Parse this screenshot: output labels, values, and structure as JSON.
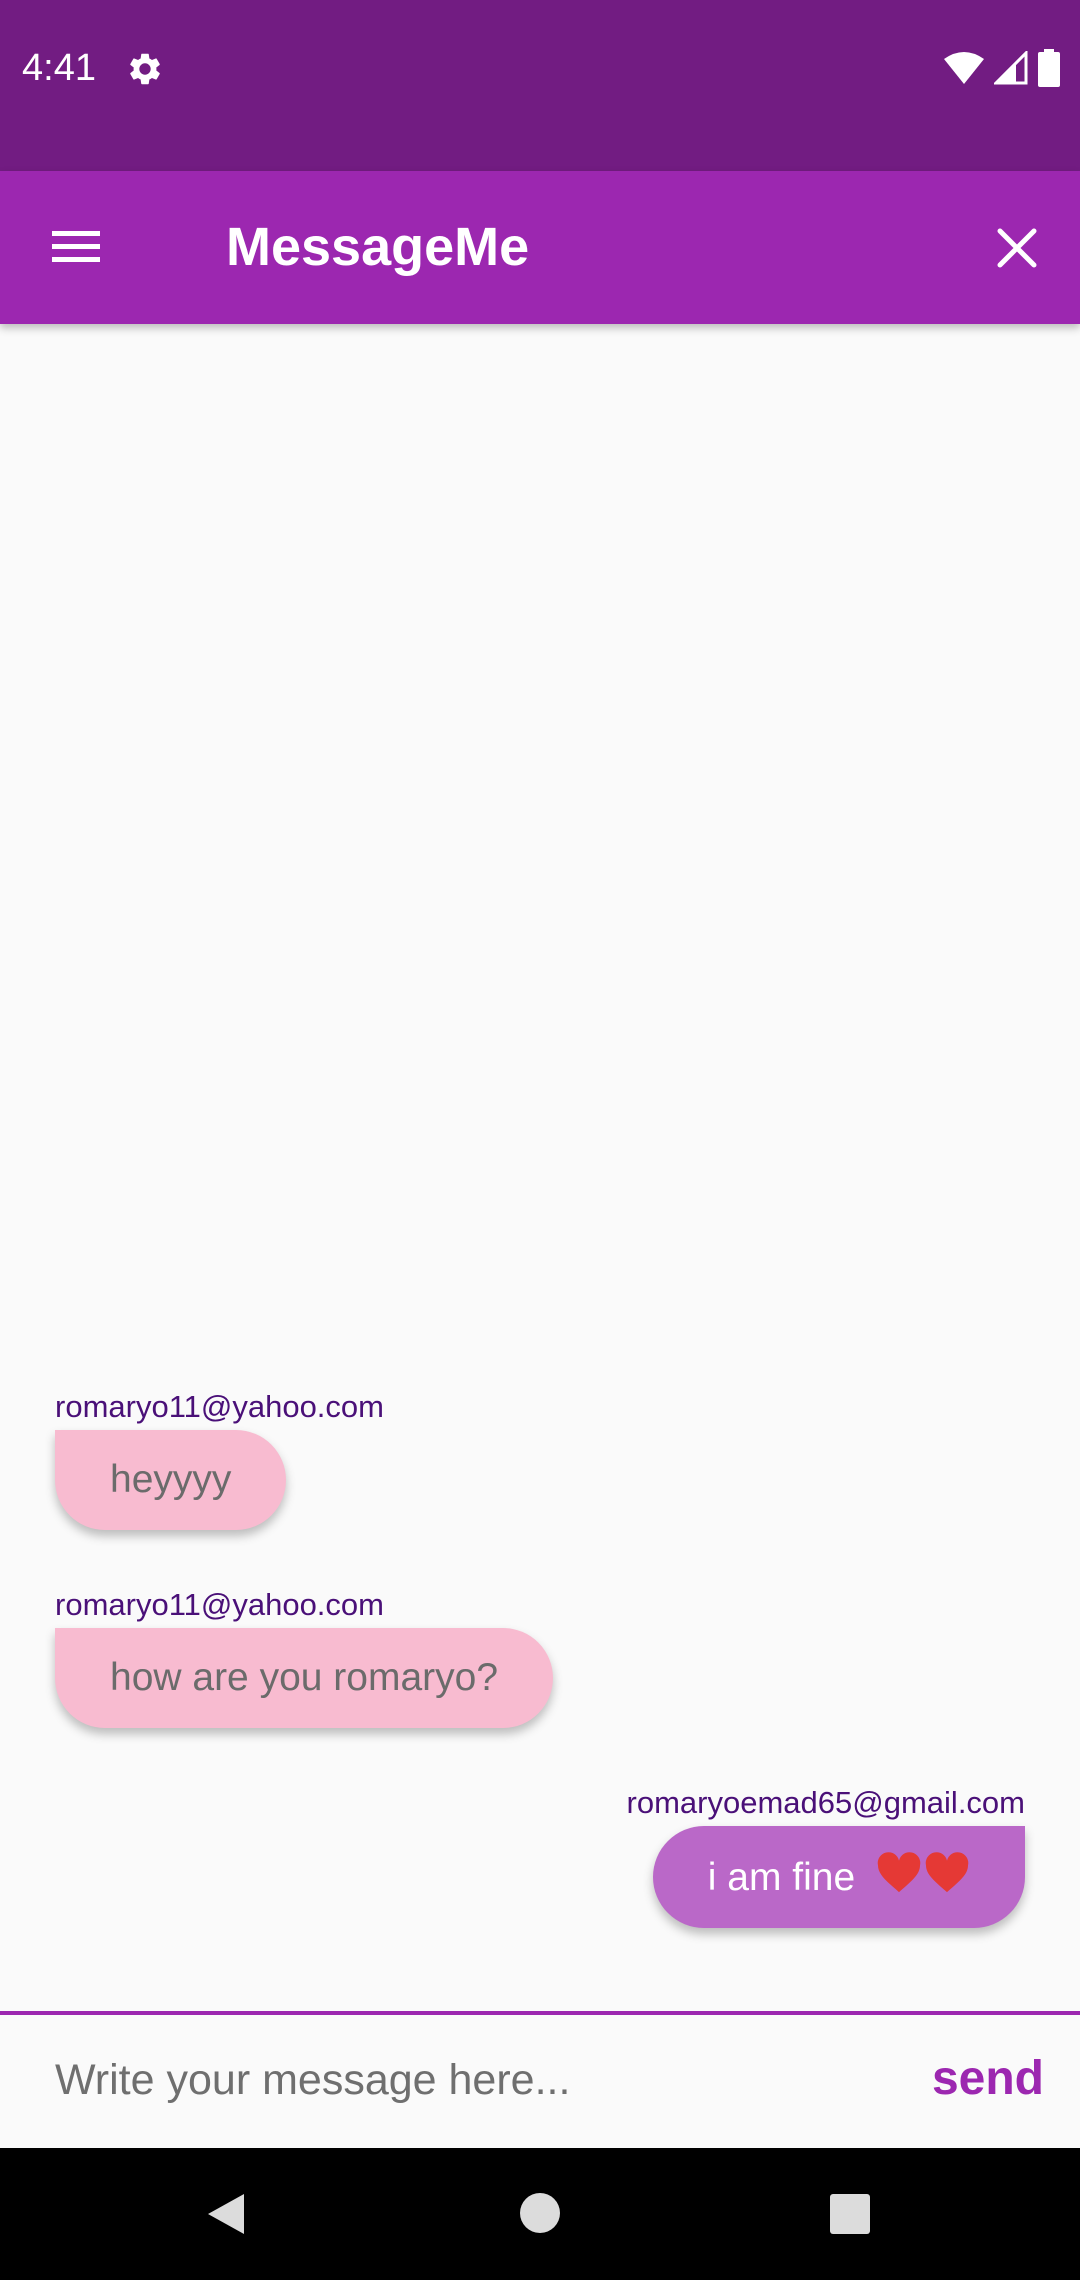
{
  "status_bar": {
    "time": "4:41",
    "icons": [
      "settings-gear-icon",
      "wifi-icon",
      "cell-signal-icon",
      "battery-icon"
    ]
  },
  "app_bar": {
    "title": "MessageMe",
    "menu_icon": "menu-icon",
    "close_icon": "close-icon",
    "color": "#9c27b0"
  },
  "messages": [
    {
      "sender": "romaryo11@yahoo.com",
      "text": "heyyyy",
      "direction": "incoming"
    },
    {
      "sender": "romaryo11@yahoo.com",
      "text": "how are you romaryo?",
      "direction": "incoming"
    },
    {
      "sender": "romaryoemad65@gmail.com",
      "text": "i am fine",
      "emoji": "heart-emoji x2",
      "direction": "outgoing"
    }
  ],
  "composer": {
    "placeholder": "Write your message here...",
    "value": "",
    "send_label": "send"
  },
  "colors": {
    "status_bar": "#721c82",
    "accent": "#9c27b0",
    "incoming_bubble": "#f8bbd0",
    "outgoing_bubble": "#ba68c8",
    "sender_text": "#4a1078"
  },
  "nav_bar": {
    "icons": [
      "back-icon",
      "home-icon",
      "recents-icon"
    ]
  }
}
